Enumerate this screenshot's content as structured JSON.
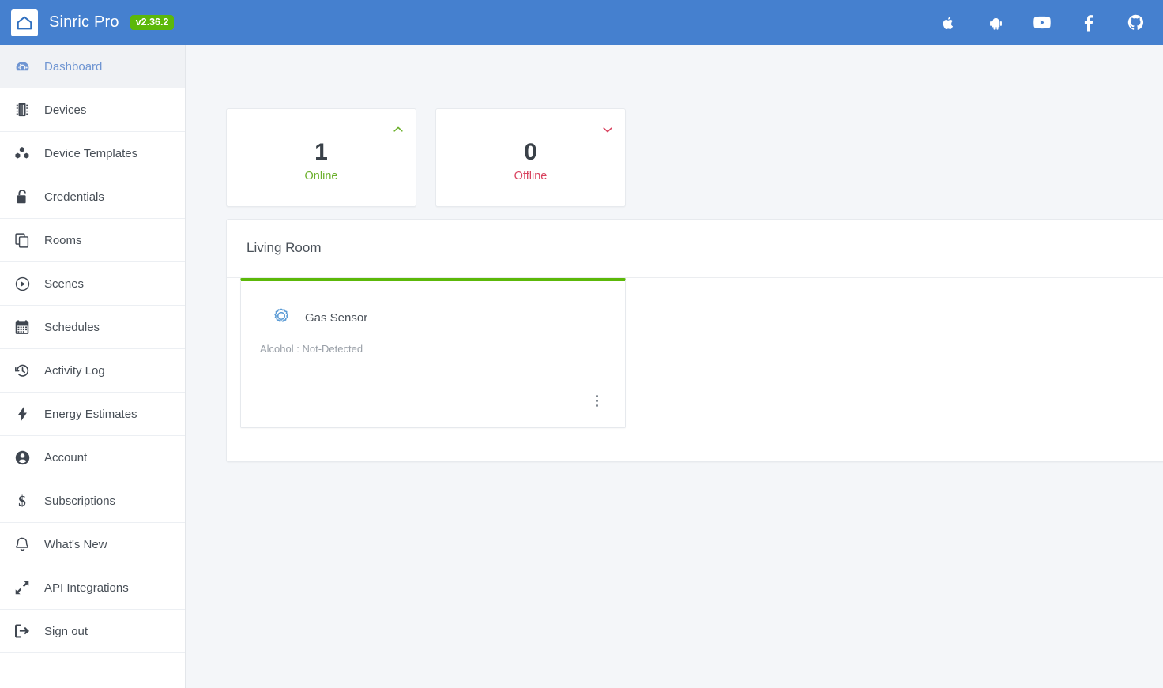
{
  "header": {
    "brand_name": "Sinric Pro",
    "version": "v2.36.2",
    "logo_icon": "home-icon",
    "social_icons": [
      {
        "name": "apple-icon",
        "label": "Apple"
      },
      {
        "name": "android-icon",
        "label": "Android"
      },
      {
        "name": "youtube-icon",
        "label": "YouTube"
      },
      {
        "name": "facebook-icon",
        "label": "Facebook"
      },
      {
        "name": "github-icon",
        "label": "GitHub"
      }
    ]
  },
  "sidebar": {
    "items": [
      {
        "label": "Dashboard",
        "icon": "dashboard-icon",
        "active": true
      },
      {
        "label": "Devices",
        "icon": "chip-icon",
        "active": false
      },
      {
        "label": "Device Templates",
        "icon": "cubes-icon",
        "active": false
      },
      {
        "label": "Credentials",
        "icon": "lock-open-icon",
        "active": false
      },
      {
        "label": "Rooms",
        "icon": "copy-icon",
        "active": false
      },
      {
        "label": "Scenes",
        "icon": "play-circle-icon",
        "active": false
      },
      {
        "label": "Schedules",
        "icon": "calendar-icon",
        "active": false
      },
      {
        "label": "Activity Log",
        "icon": "history-icon",
        "active": false
      },
      {
        "label": "Energy Estimates",
        "icon": "bolt-icon",
        "active": false
      },
      {
        "label": "Account",
        "icon": "user-circle-icon",
        "active": false
      },
      {
        "label": "Subscriptions",
        "icon": "dollar-icon",
        "active": false
      },
      {
        "label": "What's New",
        "icon": "bell-icon",
        "active": false
      },
      {
        "label": "API Integrations",
        "icon": "expand-arrows-icon",
        "active": false
      },
      {
        "label": "Sign out",
        "icon": "sign-out-icon",
        "active": false
      }
    ]
  },
  "main": {
    "stats": [
      {
        "count": "1",
        "label": "Online",
        "chevron": "chevron-up-icon",
        "color": "#6cb02c"
      },
      {
        "count": "0",
        "label": "Offline",
        "chevron": "chevron-down-icon",
        "color": "#d9435f"
      }
    ],
    "room": {
      "title": "Living Room",
      "devices": [
        {
          "name": "Gas Sensor",
          "icon": "gas-sensor-gear-icon",
          "status": "Alcohol : Not-Detected",
          "accent_color": "#5cb80a",
          "menu_icon": "kebab-menu-icon"
        }
      ]
    }
  },
  "colors": {
    "header_blue": "#4580cf",
    "badge_green": "#5cb80a",
    "accent_green": "#6cb02c",
    "accent_red": "#d9435f",
    "active_nav_blue": "#6f95d2",
    "page_bg": "#f4f6f9"
  }
}
